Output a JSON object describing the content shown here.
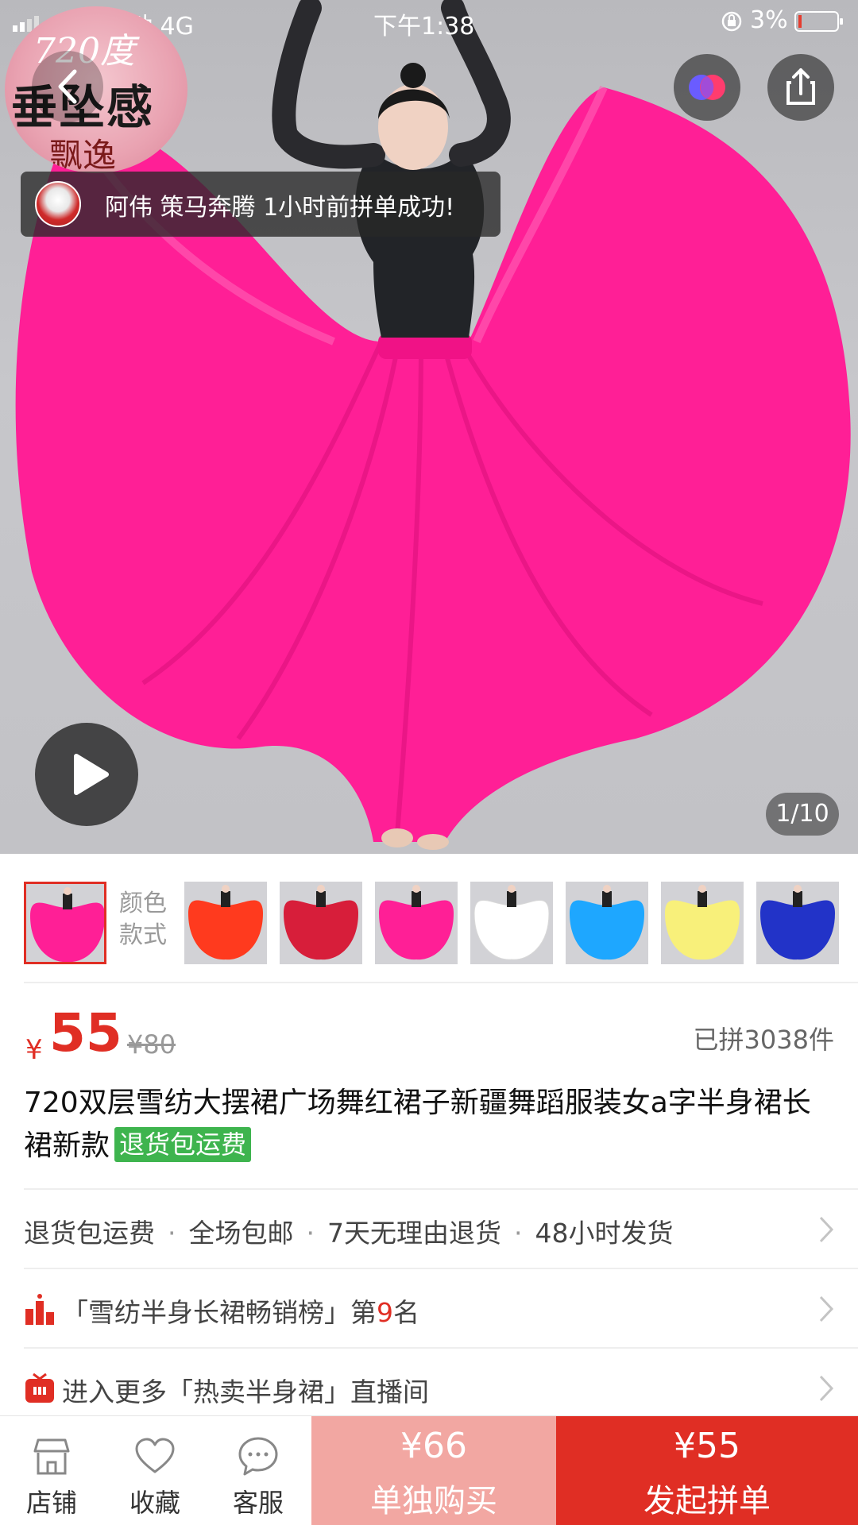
{
  "status_bar": {
    "carrier": "中国移动 4G",
    "time": "下午1:38",
    "battery": "3%"
  },
  "hero": {
    "badge_line1": "720度",
    "badge_line2": "垂坠感",
    "badge_line3": "飘逸",
    "toast_text": "阿伟 策马奔腾 1小时前拼单成功!",
    "image_counter": "1/10"
  },
  "thumbnails": {
    "label": "颜色款式",
    "items": [
      {
        "color": "#ff1f96",
        "selected": true
      },
      {
        "color": "#ff3a1e"
      },
      {
        "color": "#d71e3a"
      },
      {
        "color": "#ff1f96"
      },
      {
        "color": "#ffffff"
      },
      {
        "color": "#1ea7ff"
      },
      {
        "color": "#f8f07a"
      },
      {
        "color": "#2233c8"
      }
    ]
  },
  "price": {
    "currency": "¥",
    "current": "55",
    "original": "¥80",
    "sold": "已拼3038件"
  },
  "product": {
    "title": "720双层雪纺大摆裙广场舞红裙子新疆舞蹈服装女a字半身裙长裙新款",
    "tag": "退货包运费"
  },
  "services": {
    "items": [
      "退货包运费",
      "全场包邮",
      "7天无理由退货",
      "48小时发货"
    ]
  },
  "ranking": {
    "prefix": "「雪纺半身长裙畅销榜」第",
    "rank": "9",
    "suffix": "名"
  },
  "live": {
    "text": "进入更多「热卖半身裙」直播间"
  },
  "bottom_bar": {
    "shop": "店铺",
    "favorite": "收藏",
    "service": "客服",
    "alone_price": "¥66",
    "alone_label": "单独购买",
    "group_price": "¥55",
    "group_label": "发起拼单"
  },
  "colors": {
    "accent": "#e02e24",
    "alone_button": "#f2a7a2",
    "tag_green": "#3eb44e",
    "skirt": "#ff1f96"
  }
}
